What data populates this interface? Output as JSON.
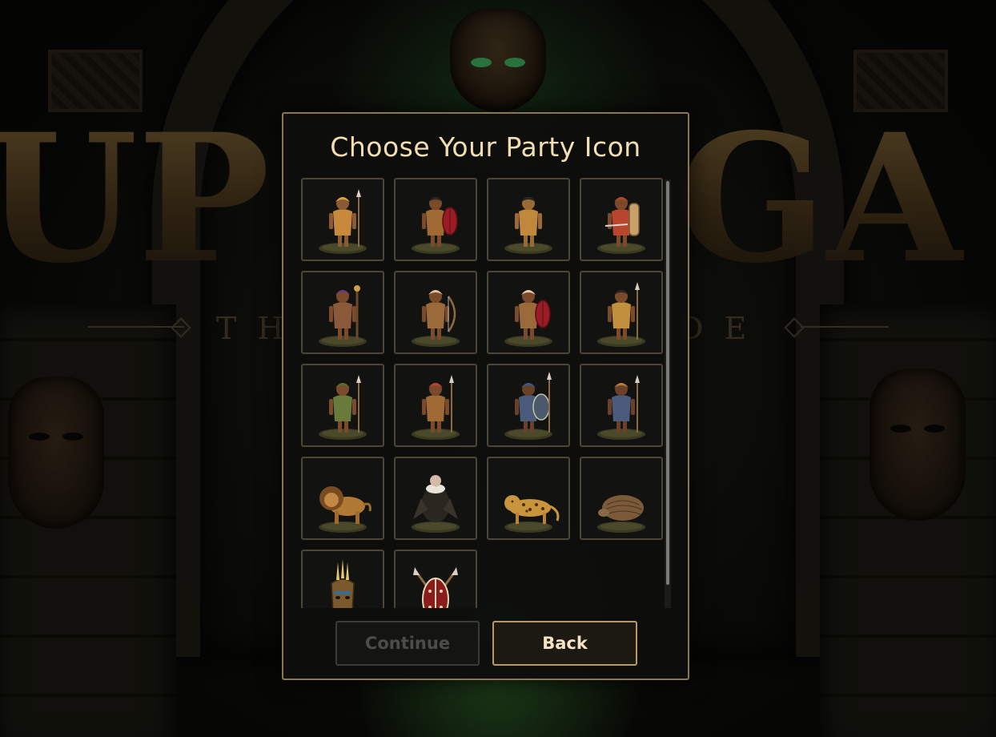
{
  "background": {
    "logo_left": "UP",
    "logo_right": "GA",
    "subtitle_left": "TH",
    "subtitle_right": "DE"
  },
  "dialog": {
    "title": "Choose Your Party Icon",
    "continue_label": "Continue",
    "continue_enabled": false,
    "back_label": "Back"
  },
  "icons": [
    {
      "name": "warrior-woman-icon",
      "kind": "figure",
      "skin": "#8a5a34",
      "cloth": "#c78a3c",
      "head": "#d9a43e",
      "weapon": "spear"
    },
    {
      "name": "shield-spear-warrior-icon",
      "kind": "figure",
      "skin": "#7a4a2a",
      "cloth": "#a06a34",
      "head": "#2a2420",
      "weapon": "shield-red"
    },
    {
      "name": "leopard-beast-icon",
      "kind": "figure",
      "skin": "#9a6a36",
      "cloth": "#c0883c",
      "head": "#2a2420",
      "weapon": "none"
    },
    {
      "name": "red-armored-swordsman-icon",
      "kind": "figure",
      "skin": "#7a4a2a",
      "cloth": "#b8452c",
      "head": "#b8452c",
      "weapon": "shield-tan"
    },
    {
      "name": "purple-shaman-icon",
      "kind": "figure",
      "skin": "#7a4a2a",
      "cloth": "#8a5a3a",
      "head": "#6a3c7c",
      "weapon": "staff"
    },
    {
      "name": "archer-icon",
      "kind": "figure",
      "skin": "#7a4a2a",
      "cloth": "#9a6a3a",
      "head": "#d8c8a0",
      "weapon": "bow"
    },
    {
      "name": "feather-chief-icon",
      "kind": "figure",
      "skin": "#7a4a2a",
      "cloth": "#9a6a3a",
      "head": "#e0d0b0",
      "weapon": "shield-red"
    },
    {
      "name": "leopard-cloak-spearman-icon",
      "kind": "figure",
      "skin": "#7a4a2a",
      "cloth": "#c0903c",
      "head": "#2a2420",
      "weapon": "spear"
    },
    {
      "name": "green-wrap-woman-icon",
      "kind": "figure",
      "skin": "#7a4a2a",
      "cloth": "#6a7a3a",
      "head": "#5a6a2c",
      "weapon": "spear"
    },
    {
      "name": "headband-spearman-icon",
      "kind": "figure",
      "skin": "#7a4a2a",
      "cloth": "#a06a34",
      "head": "#b8452c",
      "weapon": "spear"
    },
    {
      "name": "blue-shield-warrior-icon",
      "kind": "figure",
      "skin": "#6a4028",
      "cloth": "#4a5a7a",
      "head": "#3a5a8a",
      "weapon": "shield-blue"
    },
    {
      "name": "lion-mane-warrior-icon",
      "kind": "figure",
      "skin": "#6a4028",
      "cloth": "#4a5a7a",
      "head": "#c07a34",
      "weapon": "spear"
    },
    {
      "name": "lion-icon",
      "kind": "lion"
    },
    {
      "name": "vulture-icon",
      "kind": "vulture"
    },
    {
      "name": "leopard-icon",
      "kind": "leopard"
    },
    {
      "name": "pangolin-icon",
      "kind": "pangolin"
    },
    {
      "name": "tribal-mask-icon",
      "kind": "mask"
    },
    {
      "name": "crossed-spears-shield-icon",
      "kind": "crest"
    }
  ]
}
